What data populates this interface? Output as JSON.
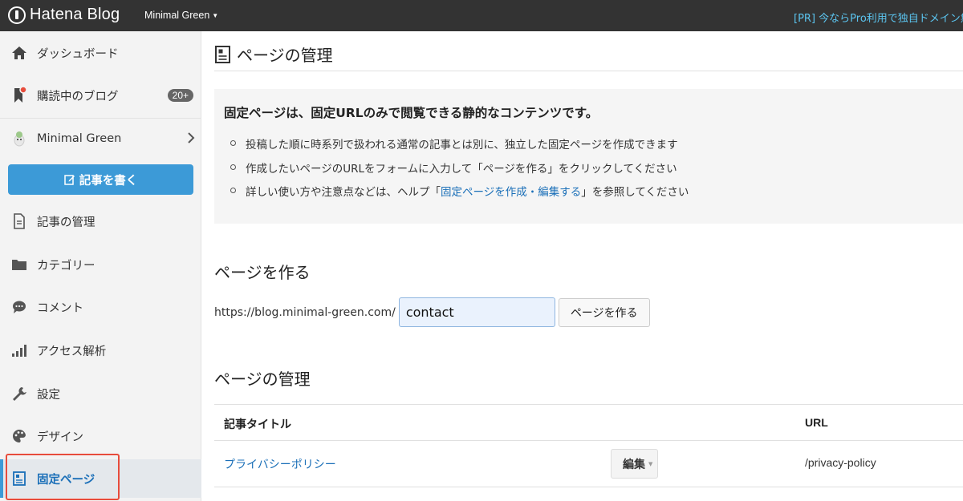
{
  "topbar": {
    "brand": "Hatena Blog",
    "blog_name": "Minimal Green",
    "promo": "[PR] 今ならPro利用で独自ドメイン無"
  },
  "sidebar": {
    "items": [
      {
        "label": "ダッシュボード",
        "icon": "home-icon"
      },
      {
        "label": "購読中のブログ",
        "icon": "bookmark-icon",
        "badge": "20+"
      },
      {
        "label": "Minimal Green",
        "icon": "blog-avatar-icon"
      },
      {
        "label": "記事の管理",
        "icon": "document-icon"
      },
      {
        "label": "カテゴリー",
        "icon": "folder-icon"
      },
      {
        "label": "コメント",
        "icon": "comment-icon"
      },
      {
        "label": "アクセス解析",
        "icon": "bar-chart-icon"
      },
      {
        "label": "設定",
        "icon": "wrench-icon"
      },
      {
        "label": "デザイン",
        "icon": "palette-icon"
      },
      {
        "label": "固定ページ",
        "icon": "page-icon"
      }
    ],
    "write_button": "記事を書く"
  },
  "main": {
    "title": "ページの管理",
    "info": {
      "title": "固定ページは、固定URLのみで閲覧できる静的なコンテンツです。",
      "bullets": [
        "投稿した順に時系列で扱われる通常の記事とは別に、独立した固定ページを作成できます",
        "作成したいページのURLをフォームに入力して「ページを作る」をクリックしてください"
      ],
      "bullet3_pre": "詳しい使い方や注意点などは、ヘルプ「",
      "bullet3_link": "固定ページを作成・編集する",
      "bullet3_post": "」を参照してください"
    },
    "create": {
      "heading": "ページを作る",
      "url_prefix": "https://blog.minimal-green.com/",
      "slug_value": "contact",
      "button": "ページを作る"
    },
    "manage": {
      "heading": "ページの管理",
      "columns": [
        "記事タイトル",
        "URL"
      ],
      "rows": [
        {
          "title": "プライバシーポリシー",
          "edit": "編集",
          "url": "/privacy-policy"
        }
      ]
    }
  },
  "colors": {
    "accent": "#3c9ad7",
    "topbar": "#333333",
    "link": "#1a6fb8",
    "highlight": "#e74c3c"
  }
}
